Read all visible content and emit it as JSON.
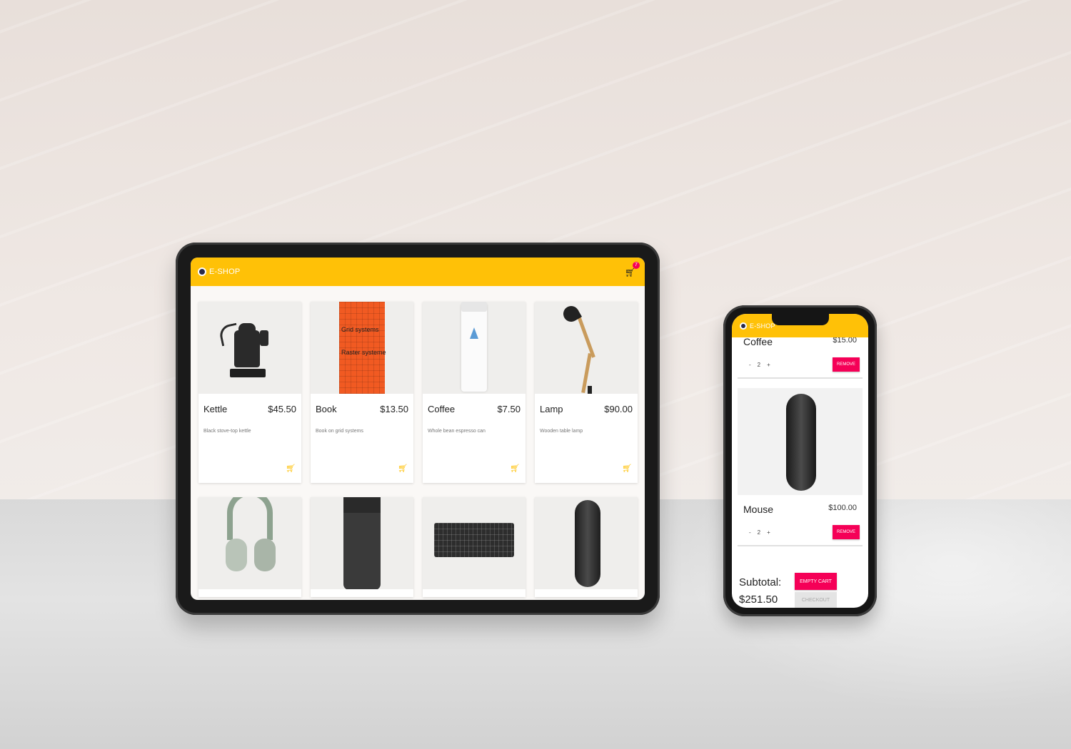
{
  "brand": "E-SHOP",
  "cart": {
    "count": "7"
  },
  "products": [
    {
      "name": "Kettle",
      "price": "$45.50",
      "description": "Black stove-top kettle"
    },
    {
      "name": "Book",
      "price": "$13.50",
      "description": "Book on grid systems",
      "cover_line1": "Grid systems",
      "cover_line2": "Raster systeme"
    },
    {
      "name": "Coffee",
      "price": "$7.50",
      "description": "Whole bean espresso can"
    },
    {
      "name": "Lamp",
      "price": "$90.00",
      "description": "Wooden table lamp"
    }
  ],
  "phone": {
    "cart_items": [
      {
        "name": "Coffee",
        "price": "$15.00",
        "quantity": "2",
        "minus": "-",
        "plus": "+",
        "remove_label": "REMOVE"
      },
      {
        "name": "Mouse",
        "price": "$100.00",
        "quantity": "2",
        "minus": "-",
        "plus": "+",
        "remove_label": "REMOVE"
      }
    ],
    "subtotal_label": "Subtotal:",
    "subtotal_value": "$251.50",
    "empty_cart_label": "EMPTY CART",
    "checkout_label": "CHECKOUT"
  },
  "icons": {
    "cart": "shopping-cart-icon",
    "add_to_cart": "add-shopping-cart-icon",
    "logo": "shop-logo-icon"
  },
  "colors": {
    "appbar": "#ffc107",
    "accent": "#f50057",
    "add_cart_icon": "#ffc107"
  }
}
